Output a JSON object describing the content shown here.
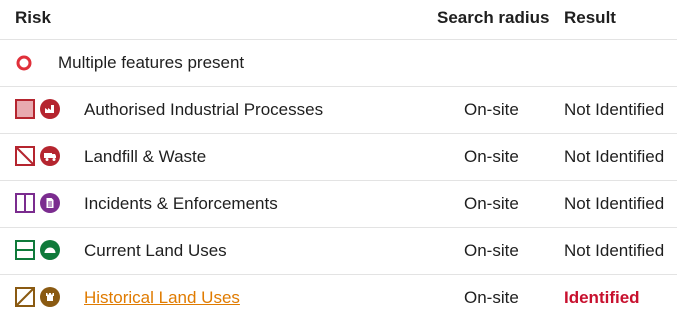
{
  "columns": {
    "risk": "Risk",
    "radius": "Search radius",
    "result": "Result"
  },
  "legend": {
    "label": "Multiple features present",
    "color": "#e0303a"
  },
  "rows": [
    {
      "name": "Authorised Industrial Processes",
      "radius": "On-site",
      "result": "Not Identified",
      "color": "#b5252f",
      "icon": "factory-icon"
    },
    {
      "name": "Landfill & Waste",
      "radius": "On-site",
      "result": "Not Identified",
      "color": "#b5252f",
      "icon": "truck-icon"
    },
    {
      "name": "Incidents & Enforcements",
      "radius": "On-site",
      "result": "Not Identified",
      "color": "#7b2c8f",
      "icon": "document-icon"
    },
    {
      "name": "Current Land Uses",
      "radius": "On-site",
      "result": "Not Identified",
      "color": "#0f7a3a",
      "icon": "dome-icon"
    },
    {
      "name": "Historical Land Uses",
      "radius": "On-site",
      "result": "Identified",
      "color": "#8a5a12",
      "icon": "castle-icon"
    }
  ]
}
